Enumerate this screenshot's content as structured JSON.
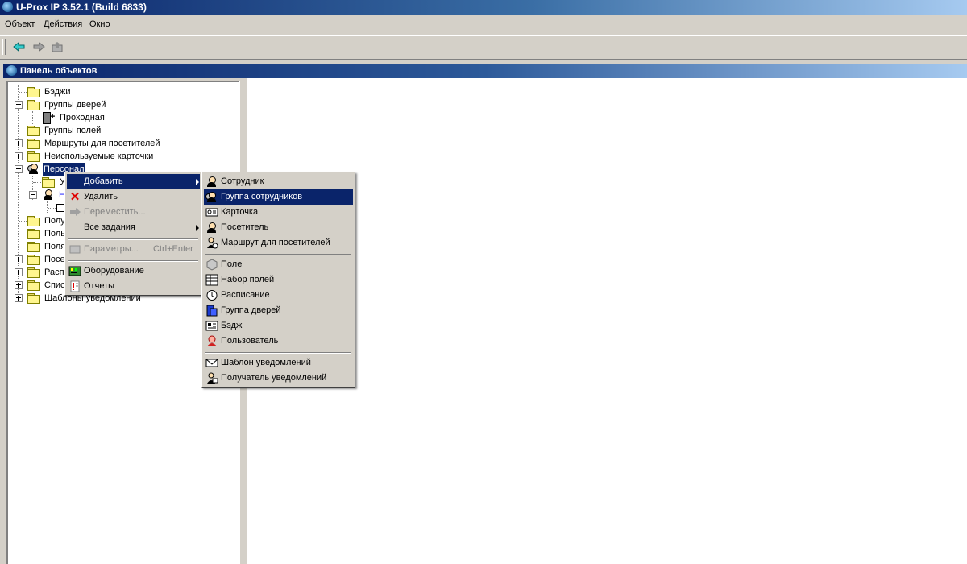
{
  "window": {
    "title": "U-Prox IP 3.52.1 (Build 6833)"
  },
  "menubar": {
    "items": [
      "Объект",
      "Действия",
      "Окно"
    ]
  },
  "toolbar": {
    "buttons": [
      "back-arrow-icon",
      "forward-arrow-icon",
      "folder-up-icon"
    ]
  },
  "panel": {
    "title": "Панель объектов"
  },
  "tree": {
    "items": [
      {
        "label": "Бэджи",
        "icon": "folder-icon"
      },
      {
        "label": "Группы дверей",
        "icon": "folder-icon",
        "expander": "minus"
      },
      {
        "label": "Проходная",
        "icon": "door-icon"
      },
      {
        "label": "Группы полей",
        "icon": "folder-icon"
      },
      {
        "label": "Маршруты для посетителей",
        "icon": "folder-icon",
        "expander": "plus"
      },
      {
        "label": "Неиспользуемые карточки",
        "icon": "folder-icon",
        "expander": "plus"
      },
      {
        "label": "Персонал",
        "icon": "employee-group-icon",
        "expander": "minus",
        "selected": true
      },
      {
        "label": "У",
        "icon": "folder-icon"
      },
      {
        "label": "Н",
        "icon": "employee-icon",
        "expander": "minus"
      },
      {
        "label": "",
        "icon": "card-icon"
      },
      {
        "label": "Полу",
        "icon": "folder-icon"
      },
      {
        "label": "Поль",
        "icon": "folder-icon"
      },
      {
        "label": "Поля",
        "icon": "folder-icon"
      },
      {
        "label": "Посе",
        "icon": "folder-icon",
        "expander": "plus"
      },
      {
        "label": "Расп",
        "icon": "folder-icon",
        "expander": "plus"
      },
      {
        "label": "Спис",
        "icon": "folder-icon",
        "expander": "plus"
      },
      {
        "label": "Шаблоны уведомлений",
        "icon": "folder-icon",
        "expander": "plus"
      }
    ]
  },
  "context_menu": {
    "items": [
      {
        "label": "Добавить",
        "submenu": true,
        "highlighted": true
      },
      {
        "label": "Удалить",
        "icon": "delete-x-icon"
      },
      {
        "label": "Переместить...",
        "icon": "move-arrow-icon",
        "disabled": true
      },
      {
        "label": "Все задания",
        "submenu": true
      },
      {
        "label": "Параметры...",
        "shortcut": "Ctrl+Enter",
        "icon": "properties-icon",
        "disabled": true
      },
      {
        "label": "Оборудование",
        "icon": "hardware-icon"
      },
      {
        "label": "Отчеты",
        "icon": "reports-icon"
      }
    ]
  },
  "submenu": {
    "items": [
      {
        "label": "Сотрудник",
        "icon": "employee-icon"
      },
      {
        "label": "Группа сотрудников",
        "icon": "employee-group-icon",
        "highlighted": true
      },
      {
        "label": "Карточка",
        "icon": "card-icon"
      },
      {
        "label": "Посетитель",
        "icon": "visitor-icon"
      },
      {
        "label": "Маршрут для посетителей",
        "icon": "visitor-route-icon"
      },
      {
        "label": "Поле",
        "icon": "field-icon"
      },
      {
        "label": "Набор полей",
        "icon": "field-set-icon"
      },
      {
        "label": "Расписание",
        "icon": "schedule-clock-icon"
      },
      {
        "label": "Группа дверей",
        "icon": "door-group-icon"
      },
      {
        "label": "Бэдж",
        "icon": "badge-icon"
      },
      {
        "label": "Пользователь",
        "icon": "user-icon"
      },
      {
        "label": "Шаблон уведомлений",
        "icon": "envelope-icon"
      },
      {
        "label": "Получатель уведомлений",
        "icon": "notification-recipient-icon"
      }
    ]
  },
  "colors": {
    "selection": "#0a246a",
    "window_face": "#d4d0c8",
    "link_blue": "#0000ff"
  }
}
